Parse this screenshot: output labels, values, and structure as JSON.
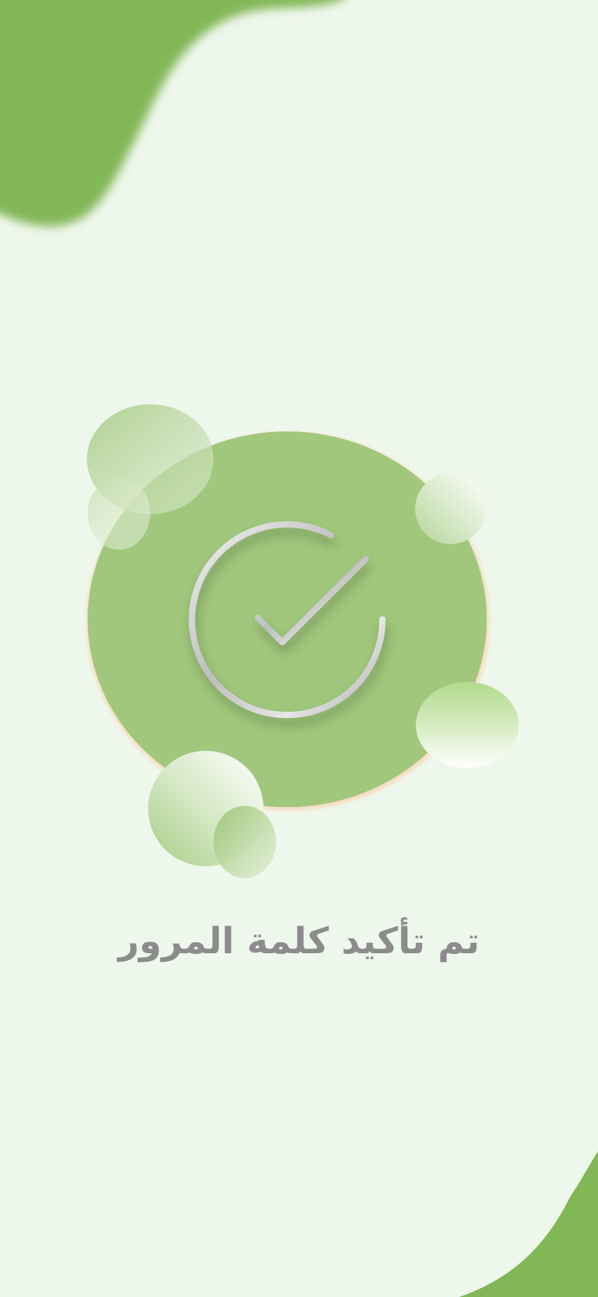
{
  "success": {
    "message": "تم تأكيد  كلمة المرور",
    "icon": "check-circle-icon"
  },
  "colors": {
    "background": "#eef7ec",
    "brand_green": "#82b756",
    "circle_green": "#a1c77c",
    "text_gray": "#8c8c8c"
  }
}
